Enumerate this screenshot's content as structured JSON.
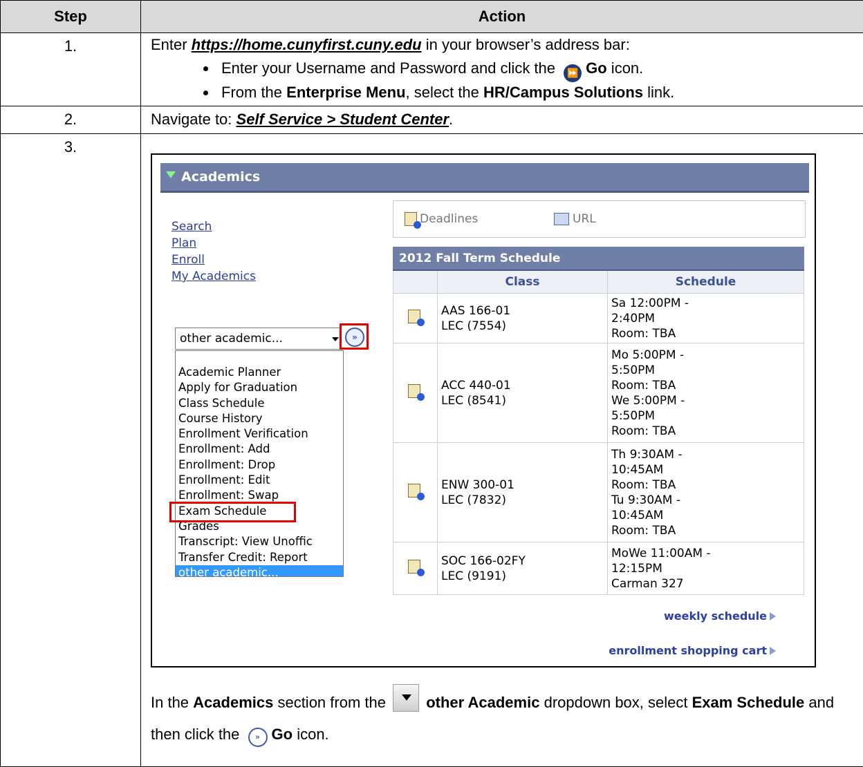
{
  "table": {
    "header_step": "Step",
    "header_action": "Action"
  },
  "rows": {
    "r1": {
      "step": "1.",
      "text_pre": "Enter ",
      "url": "https://home.cunyfirst.cuny.edu",
      "text_post": " in your browser’s address bar:",
      "b1_pre": "Enter your Username and Password and click the ",
      "b1_bold": "Go",
      "b1_post": " icon.",
      "b2_pre": "From the ",
      "b2_bold1": "Enterprise Menu",
      "b2_mid": ", select the ",
      "b2_bold2": "HR/Campus Solutions",
      "b2_post": " link."
    },
    "r2": {
      "step": "2.",
      "text_pre": "Navigate to:  ",
      "path": "Self Service > Student Center",
      "text_post": "."
    },
    "r3": {
      "step": "3."
    }
  },
  "screenshot": {
    "section_title": "Academics",
    "nav_links": [
      "Search",
      "Plan",
      "Enroll",
      "My Academics"
    ],
    "select_value": "other academic...",
    "go_glyph": "»",
    "dropdown_options": [
      "Academic Planner",
      "Apply for Graduation",
      "Class Schedule",
      "Course History",
      "Enrollment Verification",
      "Enrollment: Add",
      "Enrollment: Drop",
      "Enrollment: Edit",
      "Enrollment: Swap",
      "Exam Schedule",
      "Grades",
      "Transcript: View Unoffic",
      "Transfer Credit: Report",
      "other academic..."
    ],
    "deadlines_label": "Deadlines",
    "url_label": "URL",
    "schedule_title": "2012 Fall Term Schedule",
    "col_class": "Class",
    "col_schedule": "Schedule",
    "classes": [
      {
        "code": "AAS 166-01",
        "section": "LEC (7554)",
        "schedule": [
          "Sa 12:00PM -",
          "2:40PM",
          "Room:  TBA"
        ]
      },
      {
        "code": "ACC 440-01",
        "section": "LEC (8541)",
        "schedule": [
          "Mo 5:00PM -",
          "5:50PM",
          "Room:  TBA",
          "We 5:00PM -",
          "5:50PM",
          "Room:  TBA"
        ]
      },
      {
        "code": "ENW 300-01",
        "section": "LEC (7832)",
        "schedule": [
          "Th 9:30AM -",
          "10:45AM",
          "Room:  TBA",
          "Tu 9:30AM -",
          "10:45AM",
          "Room:  TBA"
        ]
      },
      {
        "code": "SOC 166-02FY",
        "section": "LEC (9191)",
        "schedule": [
          "MoWe 11:00AM -",
          "12:15PM",
          "Carman 327"
        ]
      }
    ],
    "weekly_link": "weekly schedule",
    "cart_link": "enrollment shopping cart"
  },
  "caption": {
    "p1": "In the ",
    "b1": "Academics",
    "p2": " section from the ",
    "b2": "other Academic",
    "p3": " dropdown box, select ",
    "b3": "Exam Schedule",
    "p4": " and then click the ",
    "b4": "Go",
    "p5": " icon."
  }
}
